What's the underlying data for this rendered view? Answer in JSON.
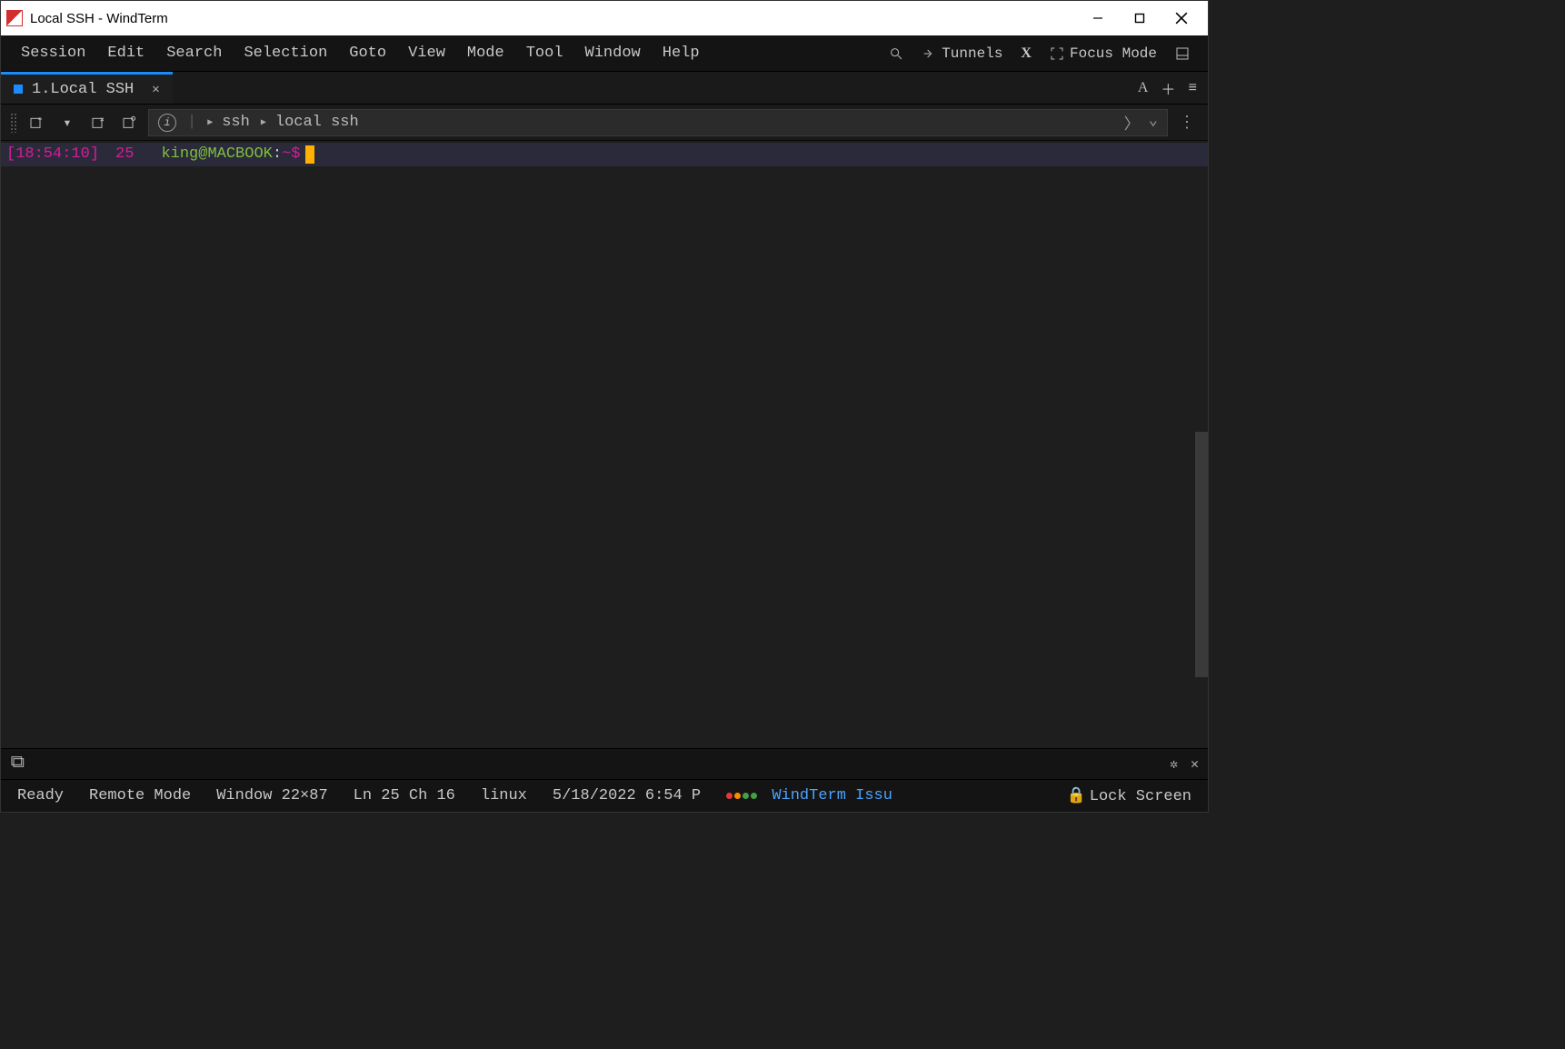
{
  "window": {
    "title": "Local SSH - WindTerm"
  },
  "menu": {
    "items": [
      "Session",
      "Edit",
      "Search",
      "Selection",
      "Goto",
      "View",
      "Mode",
      "Tool",
      "Window",
      "Help"
    ],
    "tunnels_label": "Tunnels",
    "focus_mode_label": "Focus Mode"
  },
  "tab": {
    "label": "1.Local SSH"
  },
  "path": {
    "seg1": "ssh",
    "seg2": "local ssh"
  },
  "prompt": {
    "timestamp": "[18:54:10]",
    "lineno": "25",
    "user_host": "king@MACBOOK",
    "sep": ":",
    "cwd": "~",
    "sym": "$"
  },
  "status": {
    "ready": "Ready",
    "mode": "Remote Mode",
    "winsize": "Window 22×87",
    "cursor": "Ln 25 Ch 16",
    "os": "linux",
    "datetime": "5/18/2022 6:54 P",
    "issue_link": "WindTerm Issu",
    "lock": "Lock Screen"
  }
}
